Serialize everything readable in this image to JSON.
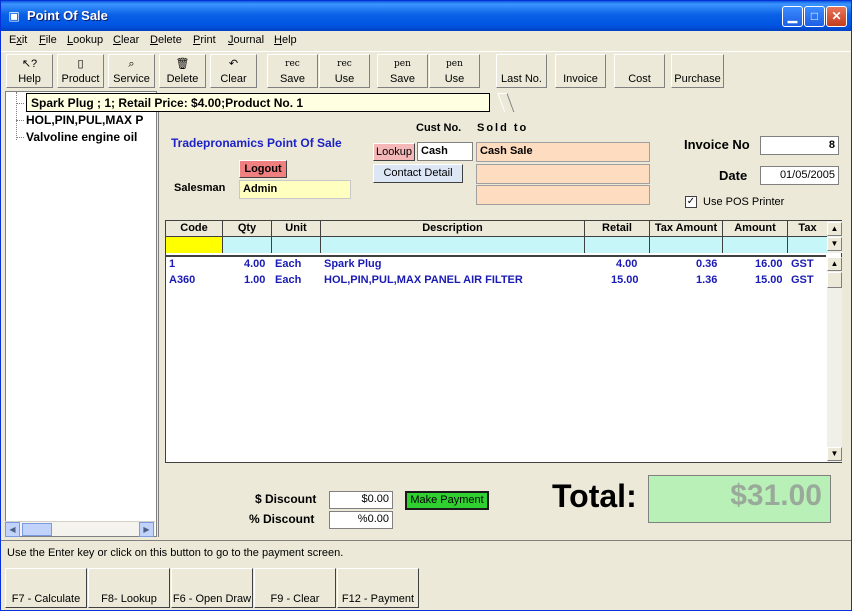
{
  "window": {
    "title": "Point Of Sale"
  },
  "menu": [
    {
      "label": "Exit",
      "key": "x",
      "rest": "it",
      "pre": "E"
    },
    {
      "label": "File",
      "key": "F",
      "rest": "ile",
      "pre": ""
    },
    {
      "label": "Lookup",
      "key": "L",
      "rest": "ookup",
      "pre": ""
    },
    {
      "label": "Clear",
      "key": "C",
      "rest": "lear",
      "pre": ""
    },
    {
      "label": "Delete",
      "key": "D",
      "rest": "elete",
      "pre": ""
    },
    {
      "label": "Print",
      "key": "P",
      "rest": "rint",
      "pre": ""
    },
    {
      "label": "Journal",
      "key": "J",
      "rest": "ournal",
      "pre": ""
    },
    {
      "label": "Help",
      "key": "H",
      "rest": "elp",
      "pre": ""
    }
  ],
  "toolbar": {
    "help": "Help",
    "product": "Product",
    "service": "Service",
    "delete": "Delete",
    "clear": "Clear",
    "rec_save_icon": "rec",
    "rec_save": "Save",
    "rec_use_icon": "rec",
    "rec_use": "Use",
    "pen_save_icon": "pen",
    "pen_save": "Save",
    "pen_use_icon": "pen",
    "pen_use": "Use",
    "last_no": "Last No.",
    "invoice": "Invoice",
    "cost": "Cost",
    "purchase": "Purchase"
  },
  "tree": {
    "selected": "Spark Plug ; 1; Retail Price: $4.00;Product No. 1",
    "items": [
      "HOL,PIN,PUL,MAX P",
      "Valvoline engine oil"
    ]
  },
  "header": {
    "company": "Tradepronamics Point Of Sale",
    "logout": "Logout",
    "salesman_label": "Salesman",
    "salesman": "Admin",
    "cust_no_label": "Cust No.",
    "sold_to_label": "Sold to",
    "lookup": "Lookup",
    "cust_no": "Cash",
    "sold_to": "Cash Sale",
    "sold_to_line2": "",
    "sold_to_line3": "",
    "contact_detail": "Contact Detail",
    "invoice_label": "Invoice No",
    "invoice_no": "8",
    "date_label": "Date",
    "date": "01/05/2005",
    "use_pos_printer": "Use POS Printer",
    "checkmark": "✓"
  },
  "grid": {
    "columns": [
      "Code",
      "Qty",
      "Unit",
      "Description",
      "Retail",
      "Tax Amount",
      "Amount",
      "Tax"
    ],
    "rows": [
      {
        "code": "1",
        "qty": "4.00",
        "unit": "Each",
        "desc": "Spark Plug",
        "retail": "4.00",
        "tax_amount": "0.36",
        "amount": "16.00",
        "tax": "GST"
      },
      {
        "code": "A360",
        "qty": "1.00",
        "unit": "Each",
        "desc": "HOL,PIN,PUL,MAX PANEL AIR FILTER",
        "retail": "15.00",
        "tax_amount": "1.36",
        "amount": "15.00",
        "tax": "GST"
      }
    ]
  },
  "footer": {
    "dollar_discount_label": "$ Discount",
    "dollar_discount": "$0.00",
    "percent_discount_label": "% Discount",
    "percent_discount": "%0.00",
    "make_payment": "Make Payment",
    "total_label": "Total:",
    "total": "$31.00"
  },
  "status": "Use the Enter key or click on this button to go to the payment screen.",
  "fkeys": [
    "F7 - Calculate",
    "F8- Lookup",
    "F6 - Open Draw",
    "F9 - Clear",
    "F12 - Payment"
  ]
}
